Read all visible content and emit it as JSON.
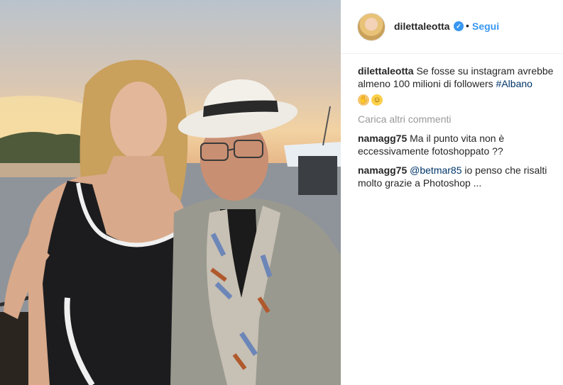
{
  "post": {
    "username": "dilettaleotta",
    "verified_icon": "verified-badge-icon",
    "separator": "•",
    "follow_label": "Segui"
  },
  "caption": {
    "username": "dilettaleotta",
    "text": "Se fosse su instagram avrebbe almeno 100 milioni di followers",
    "hashtag": "#Albano",
    "emojis": [
      "clapping-hands",
      "grinning-face"
    ]
  },
  "load_more_label": "Carica altri commenti",
  "comments": [
    {
      "username": "namagg75",
      "text": "Ma il punto vita non è eccessivamente fotoshoppato ??"
    },
    {
      "username": "namagg75",
      "mention": "@betmar85",
      "text": "io penso che risalti molto grazie a Photoshop ..."
    }
  ],
  "colors": {
    "link_blue": "#3897f0",
    "hashtag_blue": "#003569",
    "muted_gray": "#999999",
    "text": "#262626"
  }
}
